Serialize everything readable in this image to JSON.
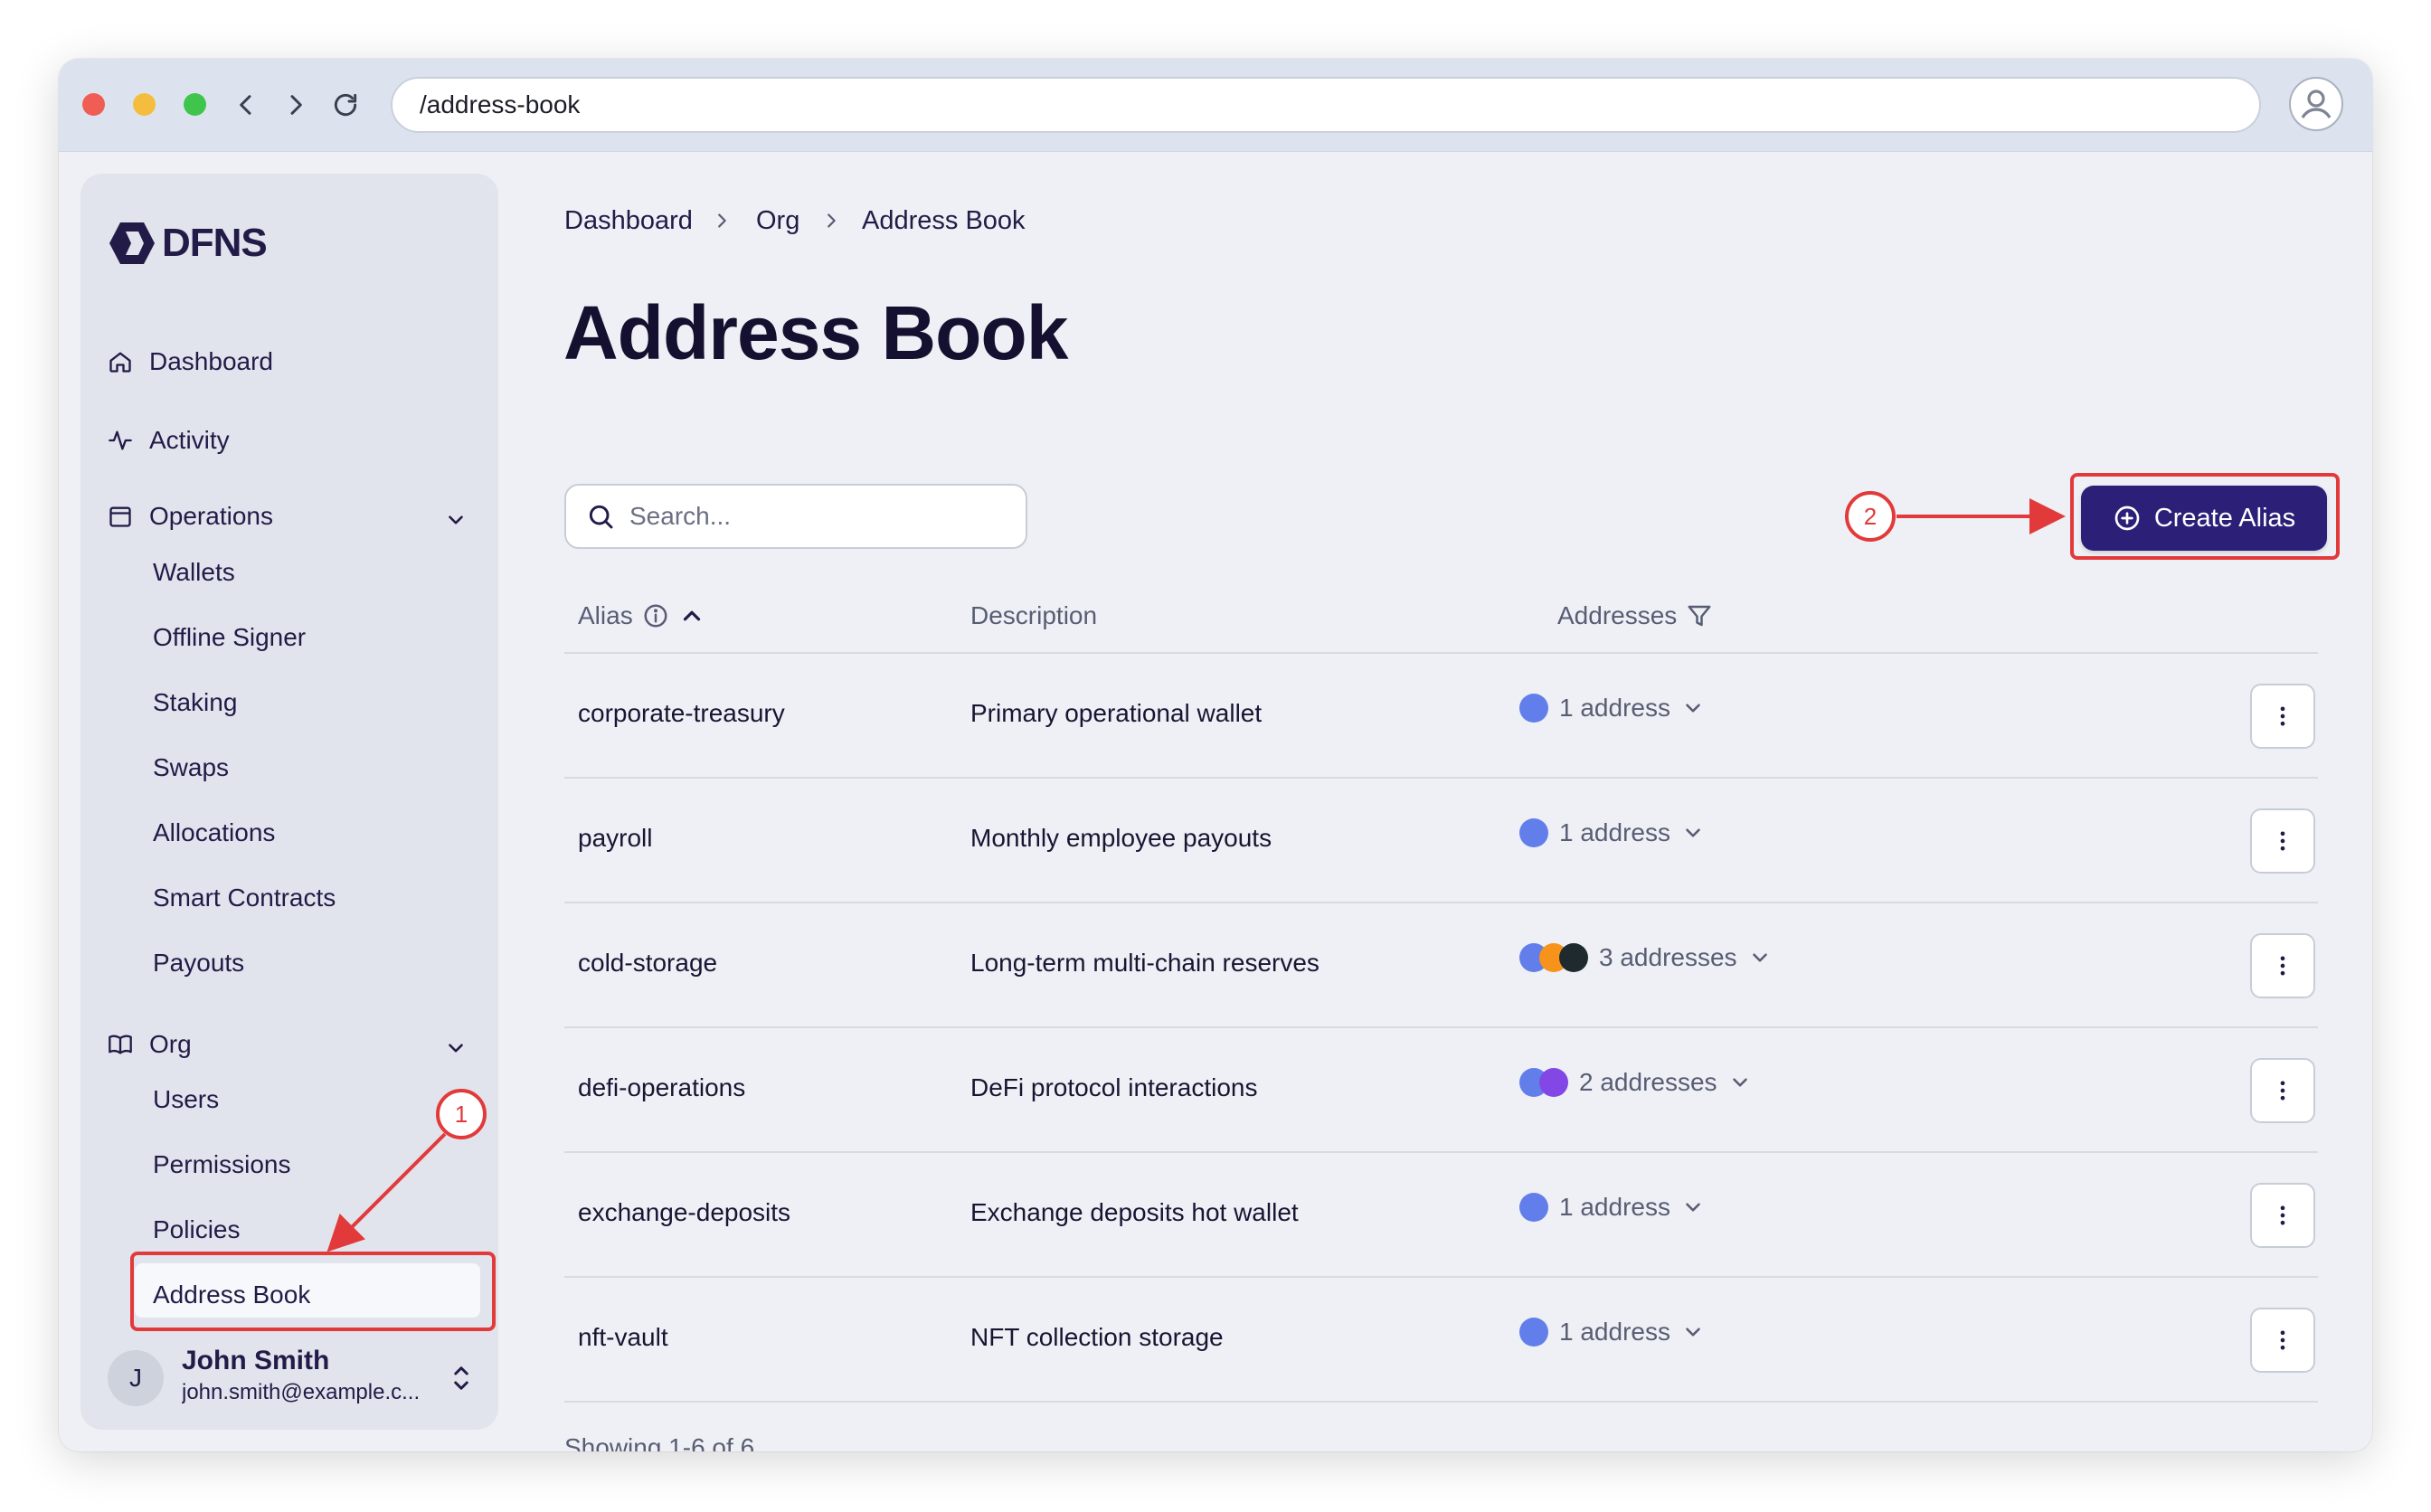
{
  "browser": {
    "url": "/address-book"
  },
  "sidebar": {
    "brand": "DFNS",
    "items": [
      {
        "label": "Dashboard",
        "icon": "home-icon"
      },
      {
        "label": "Activity",
        "icon": "activity-icon"
      },
      {
        "label": "Operations",
        "icon": "calendar-icon"
      },
      {
        "label": "Org",
        "icon": "book-icon"
      }
    ],
    "operations_sub": [
      "Wallets",
      "Offline Signer",
      "Staking",
      "Swaps",
      "Allocations",
      "Smart Contracts",
      "Payouts"
    ],
    "org_sub": [
      "Users",
      "Permissions",
      "Policies",
      "Address Book"
    ],
    "active_item": "Address Book",
    "user": {
      "initial": "J",
      "name": "John Smith",
      "email": "john.smith@example.c..."
    }
  },
  "breadcrumb": [
    "Dashboard",
    "Org",
    "Address Book"
  ],
  "page": {
    "title": "Address Book",
    "search_placeholder": "Search...",
    "create_label": "Create Alias"
  },
  "table": {
    "headers": {
      "alias": "Alias",
      "description": "Description",
      "addresses": "Addresses"
    },
    "rows": [
      {
        "alias": "corporate-treasury",
        "description": "Primary operational wallet",
        "addresses": "1 address",
        "coins": [
          "eth"
        ]
      },
      {
        "alias": "payroll",
        "description": "Monthly employee payouts",
        "addresses": "1 address",
        "coins": [
          "eth"
        ]
      },
      {
        "alias": "cold-storage",
        "description": "Long-term multi-chain reserves",
        "addresses": "3 addresses",
        "coins": [
          "eth",
          "btc",
          "sol"
        ]
      },
      {
        "alias": "defi-operations",
        "description": "DeFi protocol interactions",
        "addresses": "2 addresses",
        "coins": [
          "eth",
          "polygon"
        ]
      },
      {
        "alias": "exchange-deposits",
        "description": "Exchange deposits hot wallet",
        "addresses": "1 address",
        "coins": [
          "eth"
        ]
      },
      {
        "alias": "nft-vault",
        "description": "NFT collection storage",
        "addresses": "1 address",
        "coins": [
          "eth"
        ]
      }
    ],
    "footer": "Showing 1-6 of 6"
  },
  "annotations": {
    "step1": "1",
    "step2": "2",
    "color": "#e23a3a"
  },
  "colors": {
    "primary": "#2c1f78",
    "eth": "#627eea",
    "btc": "#f7931a",
    "sol": "#1f2a2e",
    "polygon": "#8247e5"
  }
}
